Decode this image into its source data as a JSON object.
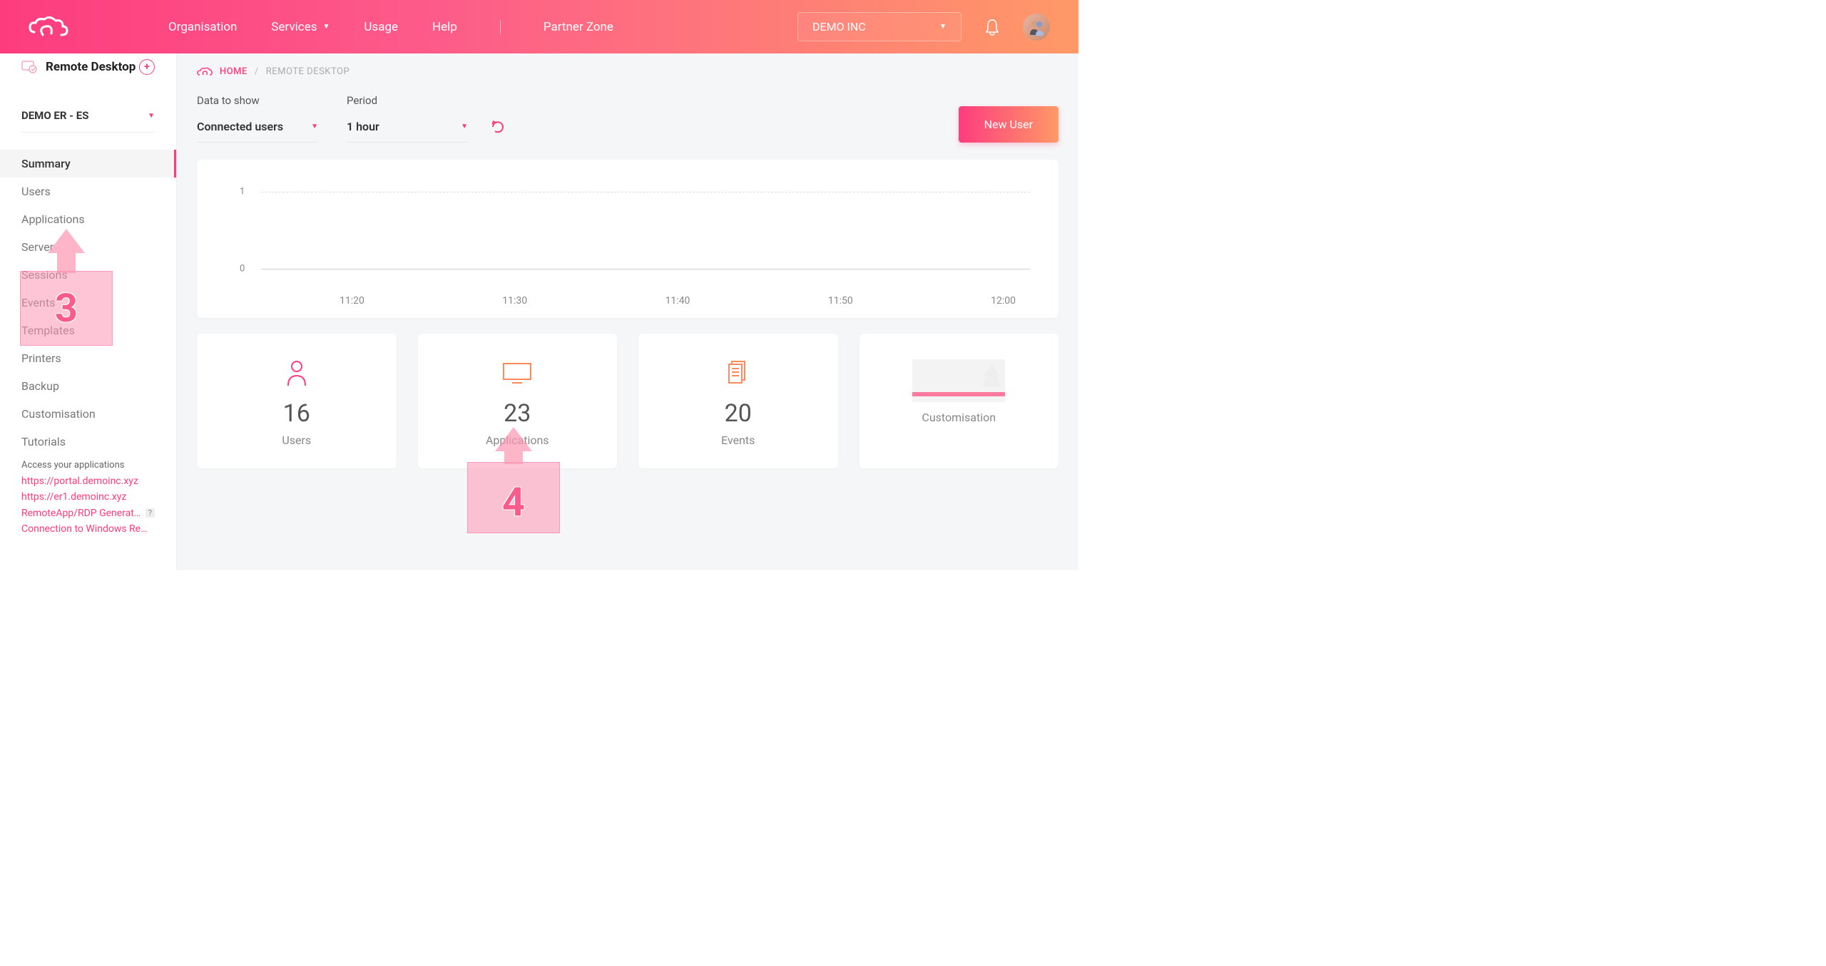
{
  "header": {
    "nav": [
      "Organisation",
      "Services",
      "Usage",
      "Help",
      "Partner Zone"
    ],
    "org_selected": "DEMO INC"
  },
  "sidebar": {
    "title": "Remote Desktop",
    "tenant": "DEMO ER - ES",
    "menu": [
      "Summary",
      "Users",
      "Applications",
      "Server",
      "Sessions",
      "Events",
      "Templates",
      "Printers",
      "Backup",
      "Customisation",
      "Tutorials"
    ],
    "active_index": 0,
    "links_label": "Access your applications",
    "links": [
      "https://portal.demoinc.xyz",
      "https://er1.demoinc.xyz",
      "RemoteApp/RDP Generator",
      "Connection to Windows Rem…"
    ]
  },
  "breadcrumb": {
    "home": "HOME",
    "current": "REMOTE DESKTOP"
  },
  "filters": {
    "data_to_show": {
      "label": "Data to show",
      "value": "Connected users"
    },
    "period": {
      "label": "Period",
      "value": "1 hour"
    }
  },
  "actions": {
    "new_user": "New User"
  },
  "chart_data": {
    "type": "line",
    "title": "",
    "xlabel": "",
    "ylabel": "",
    "ylim": [
      0,
      1
    ],
    "y_ticks": [
      0,
      1
    ],
    "x": [
      "11:20",
      "11:30",
      "11:40",
      "11:50",
      "12:00"
    ],
    "series": [
      {
        "name": "Connected users",
        "values": [
          0,
          0,
          0,
          0,
          0
        ]
      }
    ]
  },
  "stats": [
    {
      "value": "16",
      "label": "Users",
      "icon": "person"
    },
    {
      "value": "23",
      "label": "Applications",
      "icon": "monitor"
    },
    {
      "value": "20",
      "label": "Events",
      "icon": "document"
    },
    {
      "value": "",
      "label": "Customisation",
      "icon": "image"
    }
  ],
  "annotations": [
    {
      "num": "3"
    },
    {
      "num": "4"
    }
  ]
}
